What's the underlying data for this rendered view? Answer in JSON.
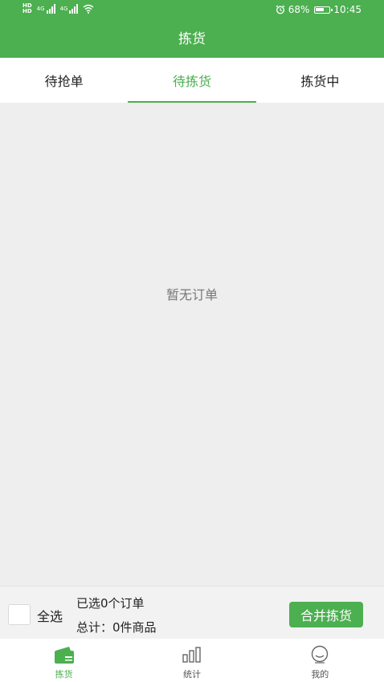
{
  "status": {
    "hd1": "HD",
    "hd2": "HD",
    "net1": "4G",
    "net2": "4G",
    "battery_percent": "68%",
    "battery_level": 0.68,
    "time": "10:45"
  },
  "header": {
    "title": "拣货"
  },
  "tabs": [
    {
      "label": "待抢单",
      "active": false
    },
    {
      "label": "待拣货",
      "active": true
    },
    {
      "label": "拣货中",
      "active": false
    }
  ],
  "content": {
    "empty_text": "暂无订单"
  },
  "actionbar": {
    "select_all_label": "全选",
    "selected_text": "已选0个订单",
    "total_text": "总计：0件商品",
    "merge_button": "合并拣货"
  },
  "bottom_nav": [
    {
      "label": "拣货",
      "icon": "wallet-icon",
      "active": true
    },
    {
      "label": "统计",
      "icon": "bar-chart-icon",
      "active": false
    },
    {
      "label": "我的",
      "icon": "smiley-icon",
      "active": false
    }
  ],
  "colors": {
    "accent": "#4caf50",
    "background": "#eeeeee"
  }
}
